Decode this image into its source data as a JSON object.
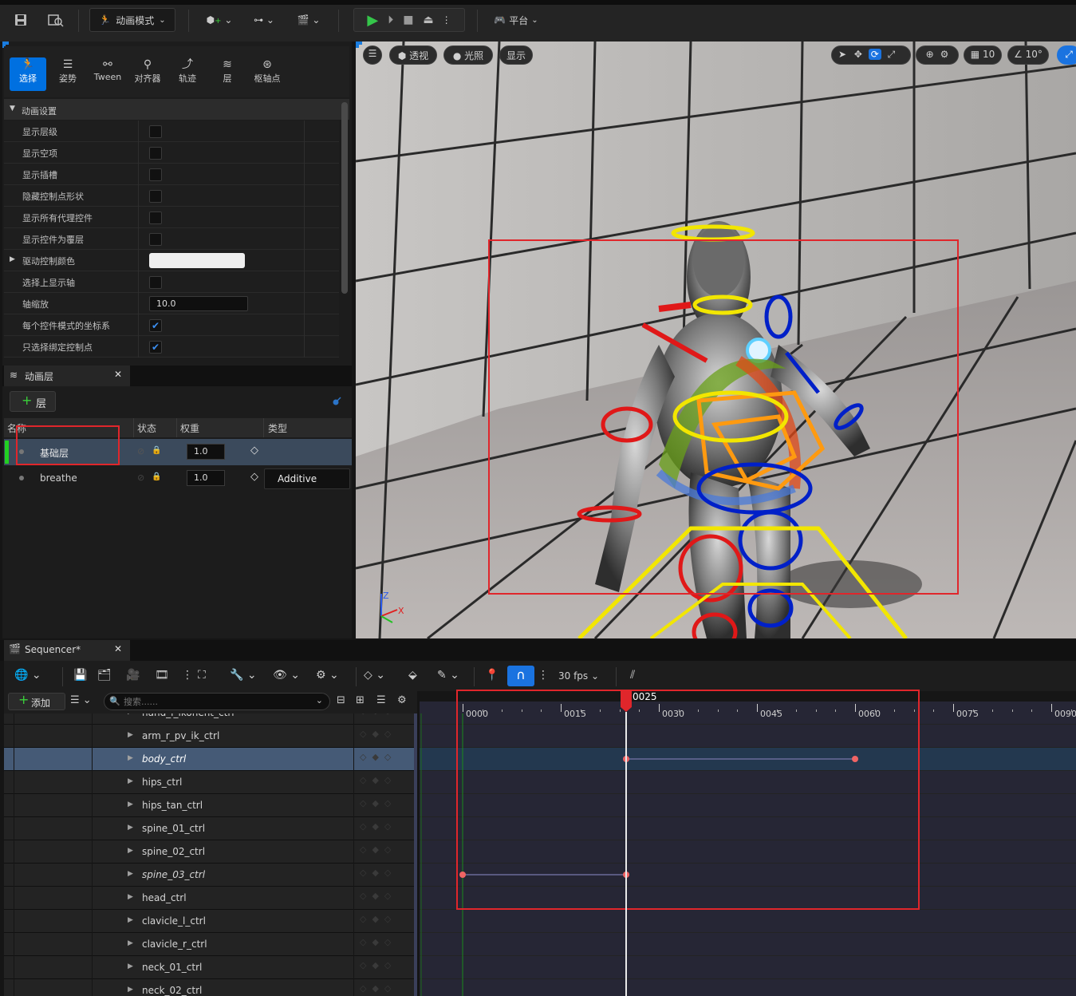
{
  "toolbar": {
    "mode_label": "动画模式",
    "platform_label": "平台"
  },
  "modes": [
    {
      "label": "选择",
      "active": true
    },
    {
      "label": "姿势",
      "active": false
    },
    {
      "label": "Tween",
      "active": false
    },
    {
      "label": "对齐器",
      "active": false
    },
    {
      "label": "轨迹",
      "active": false
    },
    {
      "label": "层",
      "active": false
    },
    {
      "label": "枢轴点",
      "active": false
    }
  ],
  "anim_settings": {
    "section_title": "动画设置",
    "rows": [
      {
        "label": "显示层级",
        "type": "checkbox",
        "checked": false
      },
      {
        "label": "显示空项",
        "type": "checkbox",
        "checked": false
      },
      {
        "label": "显示插槽",
        "type": "checkbox",
        "checked": false
      },
      {
        "label": "隐藏控制点形状",
        "type": "checkbox",
        "checked": false
      },
      {
        "label": "显示所有代理控件",
        "type": "checkbox",
        "checked": false
      },
      {
        "label": "显示控件为覆层",
        "type": "checkbox",
        "checked": false
      },
      {
        "label": "驱动控制颜色",
        "type": "color"
      },
      {
        "label": "选择上显示轴",
        "type": "checkbox",
        "checked": false
      },
      {
        "label": "轴缩放",
        "type": "number",
        "value": "10.0"
      },
      {
        "label": "每个控件模式的坐标系",
        "type": "checkbox",
        "checked": true
      },
      {
        "label": "只选择绑定控制点",
        "type": "checkbox",
        "checked": true
      }
    ]
  },
  "anim_layers": {
    "tab_title": "动画层",
    "add_label": "层",
    "columns": {
      "name": "名称",
      "state": "状态",
      "weight": "权重",
      "type": "类型"
    },
    "rows": [
      {
        "name": "基础层",
        "weight": "1.0",
        "type": "",
        "selected": true
      },
      {
        "name": "breathe",
        "weight": "1.0",
        "type": "Additive",
        "selected": false
      }
    ]
  },
  "viewport": {
    "perspective": "透视",
    "lit": "光照",
    "show": "显示",
    "grid_size": "10",
    "rot_snap": "10°",
    "axis_z": "Z",
    "axis_x": "X",
    "highlight_color": "#e0262b"
  },
  "sequencer": {
    "tab_title": "Sequencer*",
    "add_label": "添加",
    "search_placeholder": "搜索......",
    "fps": "30 fps",
    "current_frame": "0025",
    "ticks": [
      "0000",
      "0015",
      "0030",
      "0045",
      "0060",
      "0075",
      "0090"
    ],
    "tracks": [
      {
        "name": "hand_l_ikonent_ctrl",
        "italic": false,
        "selected": false
      },
      {
        "name": "arm_r_pv_ik_ctrl",
        "italic": false,
        "selected": false
      },
      {
        "name": "body_ctrl",
        "italic": true,
        "selected": true
      },
      {
        "name": "hips_ctrl",
        "italic": false,
        "selected": false
      },
      {
        "name": "hips_tan_ctrl",
        "italic": false,
        "selected": false
      },
      {
        "name": "spine_01_ctrl",
        "italic": false,
        "selected": false
      },
      {
        "name": "spine_02_ctrl",
        "italic": false,
        "selected": false
      },
      {
        "name": "spine_03_ctrl",
        "italic": true,
        "selected": false
      },
      {
        "name": "head_ctrl",
        "italic": false,
        "selected": false
      },
      {
        "name": "clavicle_l_ctrl",
        "italic": false,
        "selected": false
      },
      {
        "name": "clavicle_r_ctrl",
        "italic": false,
        "selected": false
      },
      {
        "name": "neck_01_ctrl",
        "italic": false,
        "selected": false
      },
      {
        "name": "neck_02_ctrl",
        "italic": false,
        "selected": false
      }
    ],
    "keyframes": [
      {
        "track": "body_ctrl",
        "frames": [
          25,
          60
        ]
      },
      {
        "track": "spine_03_ctrl",
        "frames": [
          0,
          25
        ]
      }
    ]
  }
}
